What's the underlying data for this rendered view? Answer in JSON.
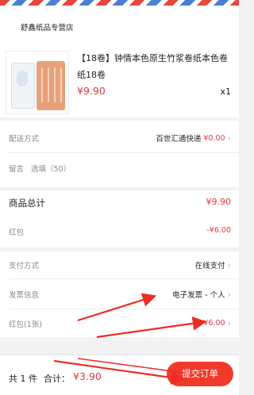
{
  "shop": {
    "name": "舒鑫纸品专营店"
  },
  "product": {
    "title": "【18卷】钟情本色原生竹浆卷纸本色卷纸18卷",
    "price": "¥9.90",
    "quantity": "x1"
  },
  "delivery": {
    "label": "配送方式",
    "value": "百世汇通快递",
    "price": "¥0.00"
  },
  "message": {
    "label": "留言",
    "placeholder": "选填（50）"
  },
  "summary": {
    "goods_total_label": "商品总计",
    "goods_total_value": "¥9.90",
    "red_packet_label": "红包",
    "red_packet_value": "-¥6.00"
  },
  "options": {
    "payment_label": "支付方式",
    "payment_value": "在线支付",
    "invoice_label": "发票信息",
    "invoice_value": "电子发票 - 个人",
    "coupon_label": "红包(1张)",
    "coupon_value": "¥6.00"
  },
  "footer": {
    "count": "共 1 件",
    "sum_label": "合计：",
    "sum_value": "¥3.90",
    "submit_label": "提交订单"
  },
  "colors": {
    "accent": "#e4393c",
    "button": "#f23a2c",
    "arrow": "#ee2b24"
  }
}
